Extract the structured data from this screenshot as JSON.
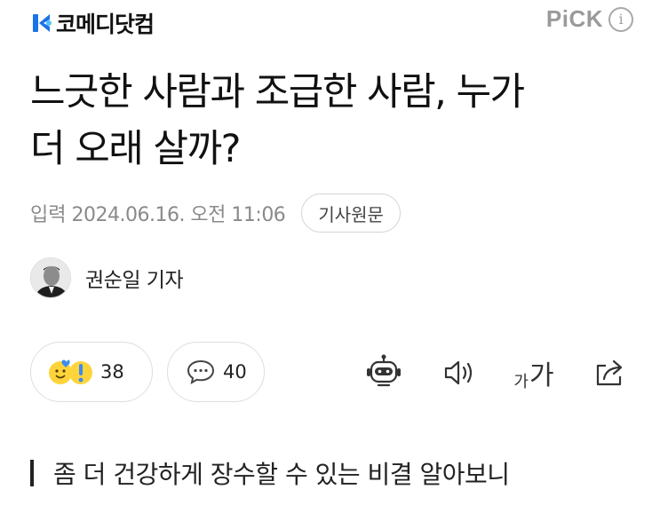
{
  "header": {
    "logo_text": "코메디닷컴",
    "pick_label": "PiCK",
    "info_glyph": "i"
  },
  "article": {
    "title_line1": "느긋한 사람과 조급한 사람, 누가",
    "title_line2": "더 오래 살까?",
    "published_label": "입력",
    "published_date": "2024.06.16. 오전 11:06",
    "origin_button": "기사원문",
    "reporter": "권순일 기자",
    "subheadline": "좀 더 건강하게 장수할 수 있는 비결 알아보니"
  },
  "reactions": {
    "emoji_count": "38",
    "comment_count": "40"
  },
  "tools": {
    "font_small": "가",
    "font_large": "가"
  },
  "icons": {
    "logo": "comedy-logo-icon",
    "info": "info-icon",
    "emoji": "reaction-emoji-icon",
    "comment": "speech-bubble-icon",
    "summary": "robot-summary-icon",
    "tts": "speaker-icon",
    "font": "font-size-icon",
    "share": "share-icon"
  },
  "colors": {
    "logo_blue": "#1a73e8",
    "pick_gray": "#9a9a9a",
    "meta_gray": "#8a8a8a",
    "emoji_yellow": "#ffd43b",
    "heart_blue": "#3d8bf2"
  }
}
